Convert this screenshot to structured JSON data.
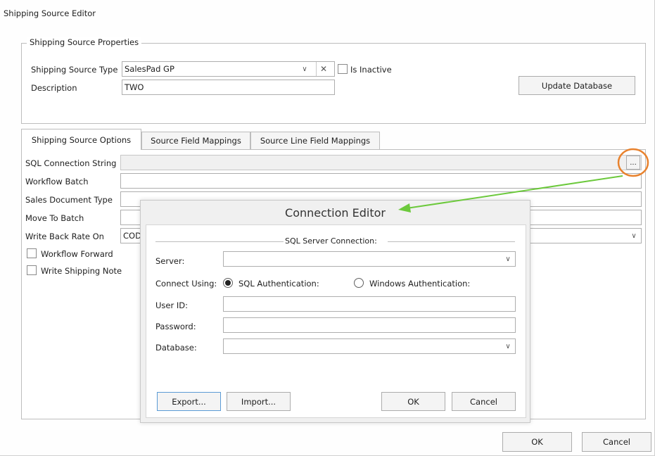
{
  "window": {
    "title": "Shipping Source Editor"
  },
  "properties": {
    "legend": "Shipping Source Properties",
    "type_label": "Shipping Source Type",
    "type_value": "SalesPad GP",
    "inactive_label": "Is Inactive",
    "description_label": "Description",
    "description_value": "TWO",
    "update_button": "Update Database"
  },
  "tabs": [
    {
      "label": "Shipping Source Options"
    },
    {
      "label": "Source Field Mappings"
    },
    {
      "label": "Source Line Field Mappings"
    }
  ],
  "options": {
    "sql_label": "SQL Connection String",
    "ellipsis": "...",
    "workflow_batch_label": "Workflow Batch",
    "sales_doc_type_label": "Sales Document Type",
    "move_to_batch_label": "Move To Batch",
    "write_back_label": "Write Back Rate On",
    "write_back_value": "COD",
    "workflow_forward_label": "Workflow Forward",
    "write_shipping_note_label": "Write Shipping Note"
  },
  "dialog": {
    "title": "Connection Editor",
    "section": "SQL Server Connection:",
    "server_label": "Server:",
    "connect_using_label": "Connect Using:",
    "sql_auth_label": "SQL Authentication:",
    "win_auth_label": "Windows Authentication:",
    "userid_label": "User ID:",
    "password_label": "Password:",
    "database_label": "Database:",
    "export_button": "Export...",
    "import_button": "Import...",
    "ok_button": "OK",
    "cancel_button": "Cancel"
  },
  "footer": {
    "ok_button": "OK",
    "cancel_button": "Cancel"
  },
  "annotation": {
    "circle_color": "#e8822e",
    "arrow_color": "#6cc93c"
  }
}
